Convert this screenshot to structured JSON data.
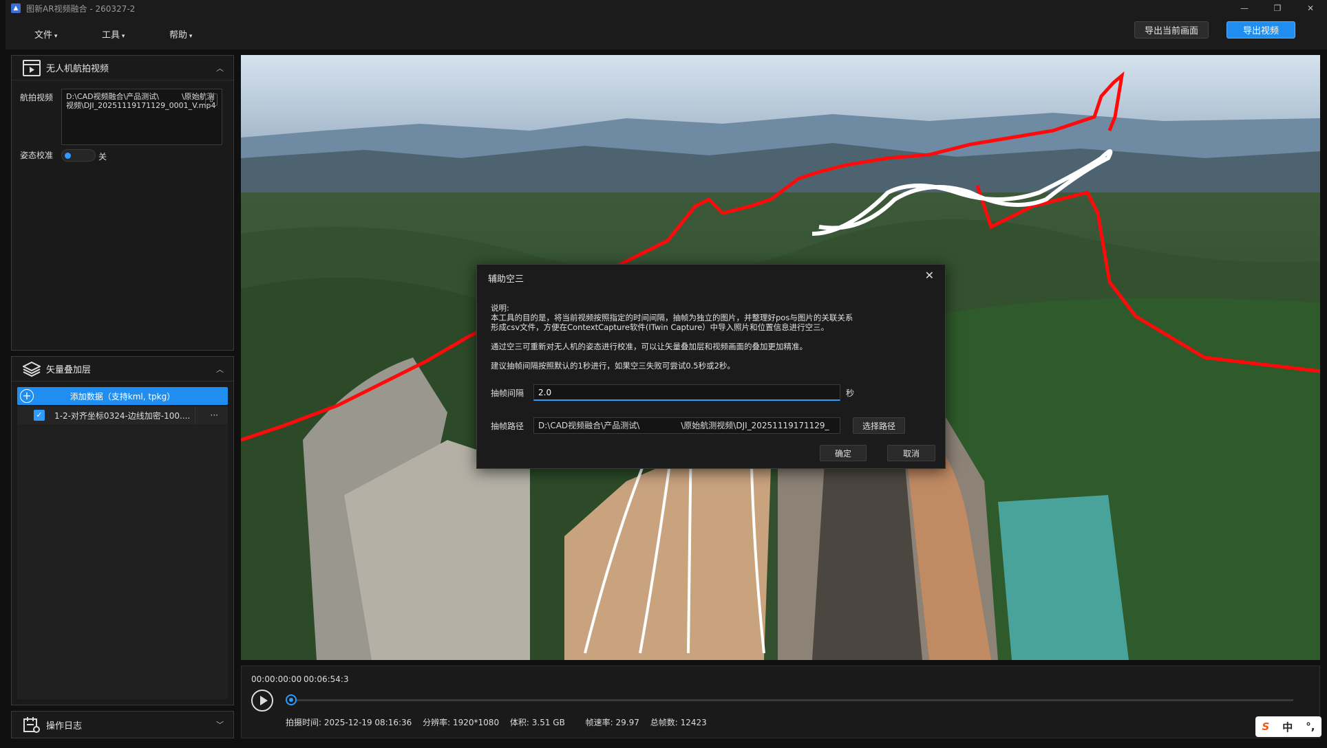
{
  "window": {
    "title": "图新AR视频融合 - 260327-2",
    "minimize": "—",
    "restore": "❐",
    "close": "✕"
  },
  "menu": {
    "file": "文件",
    "tools": "工具",
    "help": "帮助"
  },
  "toolbar": {
    "export_frame": "导出当前画面",
    "export_video": "导出视频"
  },
  "video_panel": {
    "title": "无人机航拍视频",
    "video_label": "航拍视频",
    "video_path": "D:\\CAD视频融合\\产品测试\\　　　\\原始航测视频\\DJI_20251119171129_0001_V.mp4",
    "pose_label": "姿态校准",
    "pose_state": "关"
  },
  "vector_panel": {
    "title": "矢量叠加层",
    "add_data": "添加数据（支持kml, tpkg）",
    "layers": [
      {
        "name": "1-2-对齐坐标0324-边线加密-100....",
        "more": "···"
      }
    ]
  },
  "log_panel": {
    "title": "操作日志"
  },
  "playback": {
    "current_time": "00:00:00:00",
    "total_time": "00:06:54:3",
    "progress": 0.0,
    "shoot_time": "拍摄时间: 2025-12-19 08:16:36",
    "resolution": "分辨率: 1920*1080",
    "size": "体积: 3.51 GB",
    "fps": "帧速率: 29.97",
    "total_frames": "总帧数: 12423"
  },
  "dialog": {
    "title": "辅助空三",
    "desc": [
      "说明:",
      "本工具的目的是，将当前视频按照指定的时间间隔，抽帧为独立的图片，并整理好pos与图片的关联关系",
      "形成csv文件，方便在ContextCapture软件(ITwin Capture）中导入照片和位置信息进行空三。",
      "",
      "通过空三可重新对无人机的姿态进行校准，可以让矢量叠加层和视频画面的叠加更加精准。",
      "",
      "建议抽帧间隔按照默认的1秒进行，如果空三失败可尝试0.5秒或2秒。"
    ],
    "interval_label": "抽帧间隔",
    "interval_value": "2.0",
    "interval_unit": "秒",
    "path_label": "抽帧路径",
    "path_value": "D:\\CAD视频融合\\产品测试\\　　　　　\\原始航测视频\\DJI_20251119171129_",
    "choose_path": "选择路径",
    "ok": "确定",
    "cancel": "取消"
  },
  "ime": {
    "logo": "S",
    "mode": "中",
    "punct": "°,"
  },
  "colors": {
    "accent": "#1f8ef0",
    "overlay_red": "#ff0a0a",
    "overlay_white": "#ffffff"
  }
}
